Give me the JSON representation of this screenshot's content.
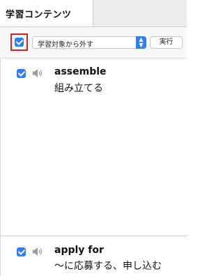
{
  "tabs": [
    {
      "label": "学習コンテンツ"
    }
  ],
  "toolbar": {
    "select_all_checked": true,
    "action_select_value": "学習対象から外す",
    "run_label": "実行"
  },
  "items": [
    {
      "term": "assemble",
      "meaning": "組み立てる",
      "checked": true
    },
    {
      "term": "apply for",
      "meaning": "〜に応募する、申し込む",
      "checked": true
    }
  ],
  "colors": {
    "accent": "#2d7ef7",
    "highlight": "#e02020"
  },
  "icons": {
    "speaker": "speaker-icon",
    "checkbox": "checkbox-checked-icon",
    "select_arrows": "up-down-chevron-icon"
  }
}
